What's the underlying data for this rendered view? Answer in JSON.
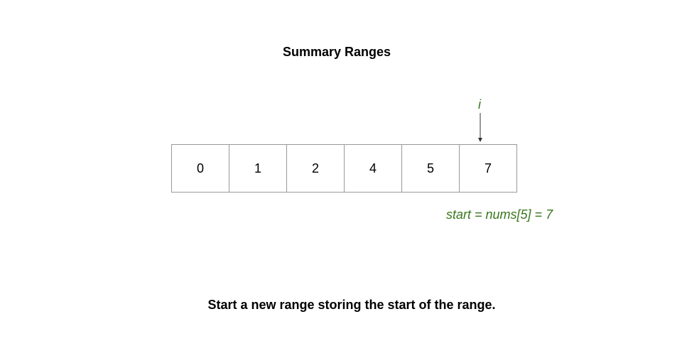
{
  "title": "Summary Ranges",
  "pointer": {
    "label": "i",
    "index": 5,
    "color": "#38761d",
    "arrow_icon": "down-arrow-icon"
  },
  "array": {
    "values": [
      "0",
      "1",
      "2",
      "4",
      "5",
      "7"
    ],
    "border_color": "#999999"
  },
  "annotation": "start = nums[5] = 7",
  "caption": "Start a new range storing the start of the range."
}
